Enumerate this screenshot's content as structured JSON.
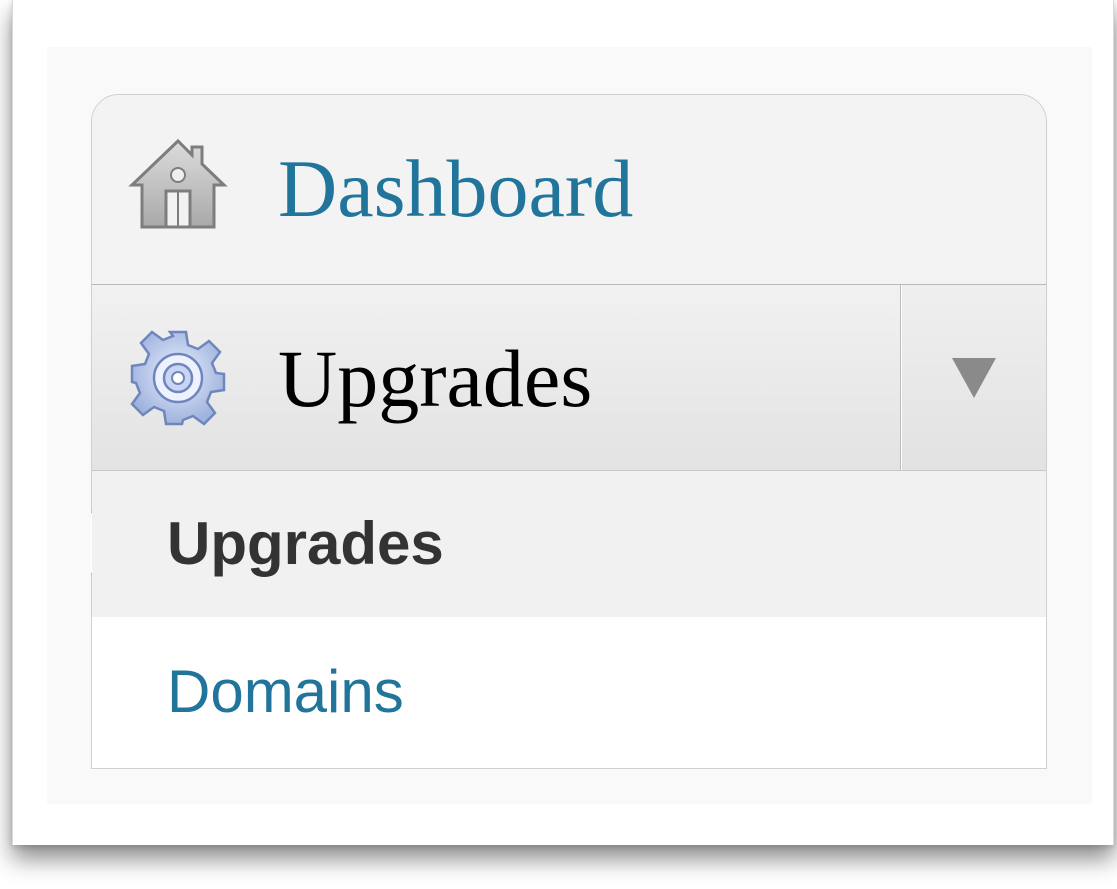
{
  "menu": {
    "dashboard": {
      "label": "Dashboard",
      "icon": "house-icon"
    },
    "upgrades": {
      "label": "Upgrades",
      "icon": "gear-icon",
      "toggle_icon": "triangle-down-icon",
      "submenu": [
        {
          "label": "Upgrades",
          "current": true
        },
        {
          "label": "Domains",
          "current": false
        }
      ]
    }
  },
  "colors": {
    "link": "#21759b",
    "current_text": "#333333",
    "active_header_text": "#000000",
    "toggle_arrow": "#8a8a8a",
    "current_bg": "#f1f1f1",
    "panel_bg": "#f9f9f9"
  }
}
